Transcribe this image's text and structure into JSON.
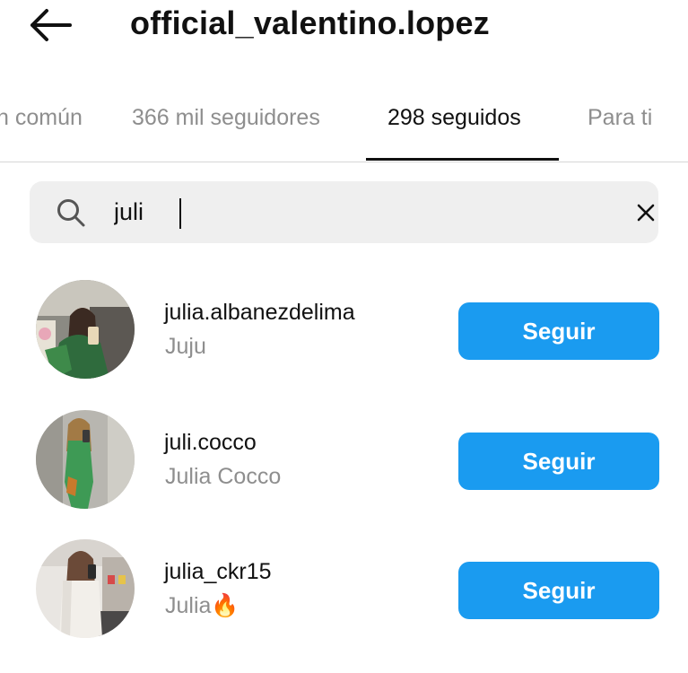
{
  "header": {
    "title": "official_valentino.lopez",
    "back_icon": "arrow-left-icon"
  },
  "tabs": [
    {
      "label": "n común",
      "active": false
    },
    {
      "label": "366 mil seguidores",
      "active": false
    },
    {
      "label": "298 seguidos",
      "active": true
    },
    {
      "label": "Para ti",
      "active": false
    }
  ],
  "search": {
    "value": "juli",
    "search_icon": "search-icon",
    "clear_icon": "close-icon"
  },
  "results": [
    {
      "username": "julia.albanezdelima",
      "full_name": "Juju",
      "button_label": "Seguir"
    },
    {
      "username": "juli.cocco",
      "full_name": "Julia Cocco",
      "button_label": "Seguir"
    },
    {
      "username": "julia_ckr15",
      "full_name": "Julia🔥",
      "button_label": "Seguir"
    }
  ],
  "colors": {
    "follow_button": "#1a9bf0",
    "secondary_text": "#8e8e8e",
    "search_bg": "#efefef"
  }
}
